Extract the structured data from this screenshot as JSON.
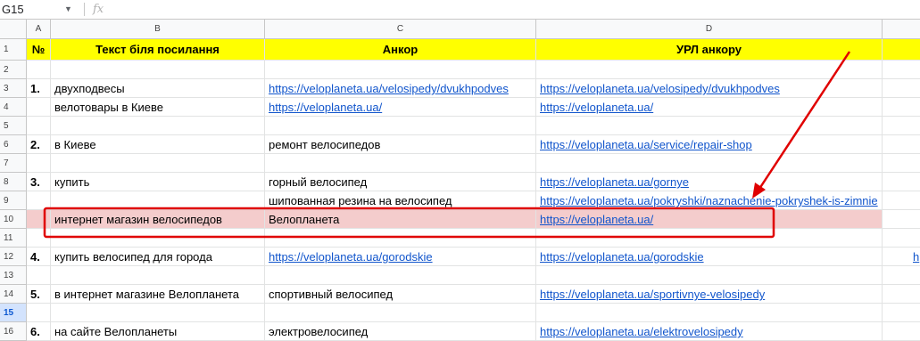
{
  "formula_bar": {
    "name_box": "G15",
    "fx_label": "fx"
  },
  "columns": [
    "A",
    "B",
    "C",
    "D",
    ""
  ],
  "rows": [
    {
      "num": "1",
      "a": "№",
      "b": "Текст біля посилання",
      "c": "Анкор",
      "d": "УРЛ анкору",
      "style": "header"
    },
    {
      "num": "2",
      "a": "",
      "b": "",
      "c": "",
      "d": ""
    },
    {
      "num": "3",
      "a": "1.",
      "b": "двухподвесы",
      "c": "https://veloplaneta.ua/velosipedy/dvukhpodves",
      "d": "https://veloplaneta.ua/velosipedy/dvukhpodves",
      "c_link": true
    },
    {
      "num": "4",
      "a": "",
      "b": "велотовары в Киеве",
      "c": "https://veloplaneta.ua/",
      "d": "https://veloplaneta.ua/",
      "c_link": true
    },
    {
      "num": "5",
      "a": "",
      "b": "",
      "c": "",
      "d": ""
    },
    {
      "num": "6",
      "a": "2.",
      "b": "в Киеве",
      "c": "ремонт велосипедов",
      "d": "https://veloplaneta.ua/service/repair-shop"
    },
    {
      "num": "7",
      "a": "",
      "b": "",
      "c": "",
      "d": ""
    },
    {
      "num": "8",
      "a": "3.",
      "b": "купить",
      "c": "горный велосипед",
      "d": "https://veloplaneta.ua/gornye"
    },
    {
      "num": "9",
      "a": "",
      "b": "",
      "c": "шипованная резина на велосипед",
      "d": "https://veloplaneta.ua/pokryshki/naznachenie-pokryshek-is-zimnie"
    },
    {
      "num": "10",
      "a": "",
      "b": "интернет магазин велосипедов",
      "c": "Велопланета",
      "d": "https://veloplaneta.ua/",
      "style": "pink"
    },
    {
      "num": "11",
      "a": "",
      "b": "",
      "c": "",
      "d": ""
    },
    {
      "num": "12",
      "a": "4.",
      "b": "купить велосипед для города",
      "c": "https://veloplaneta.ua/gorodskie",
      "d": "https://veloplaneta.ua/gorodskie",
      "c_link": true,
      "e": "h"
    },
    {
      "num": "13",
      "a": "",
      "b": "",
      "c": "",
      "d": ""
    },
    {
      "num": "14",
      "a": "5.",
      "b": "в интернет магазине Велопланета",
      "c": "спортивный велосипед",
      "d": "https://veloplaneta.ua/sportivnye-velosipedy"
    },
    {
      "num": "15",
      "a": "",
      "b": "",
      "c": "",
      "d": "",
      "active": true
    },
    {
      "num": "16",
      "a": "6.",
      "b": "на сайте Велопланеты",
      "c": "электровелосипед",
      "d": "https://veloplaneta.ua/elektrovelosipedy"
    }
  ],
  "colors": {
    "header_fill": "#ffff00",
    "highlight_fill": "#f4cccc",
    "annotation": "#e00000",
    "link": "#1155cc"
  }
}
